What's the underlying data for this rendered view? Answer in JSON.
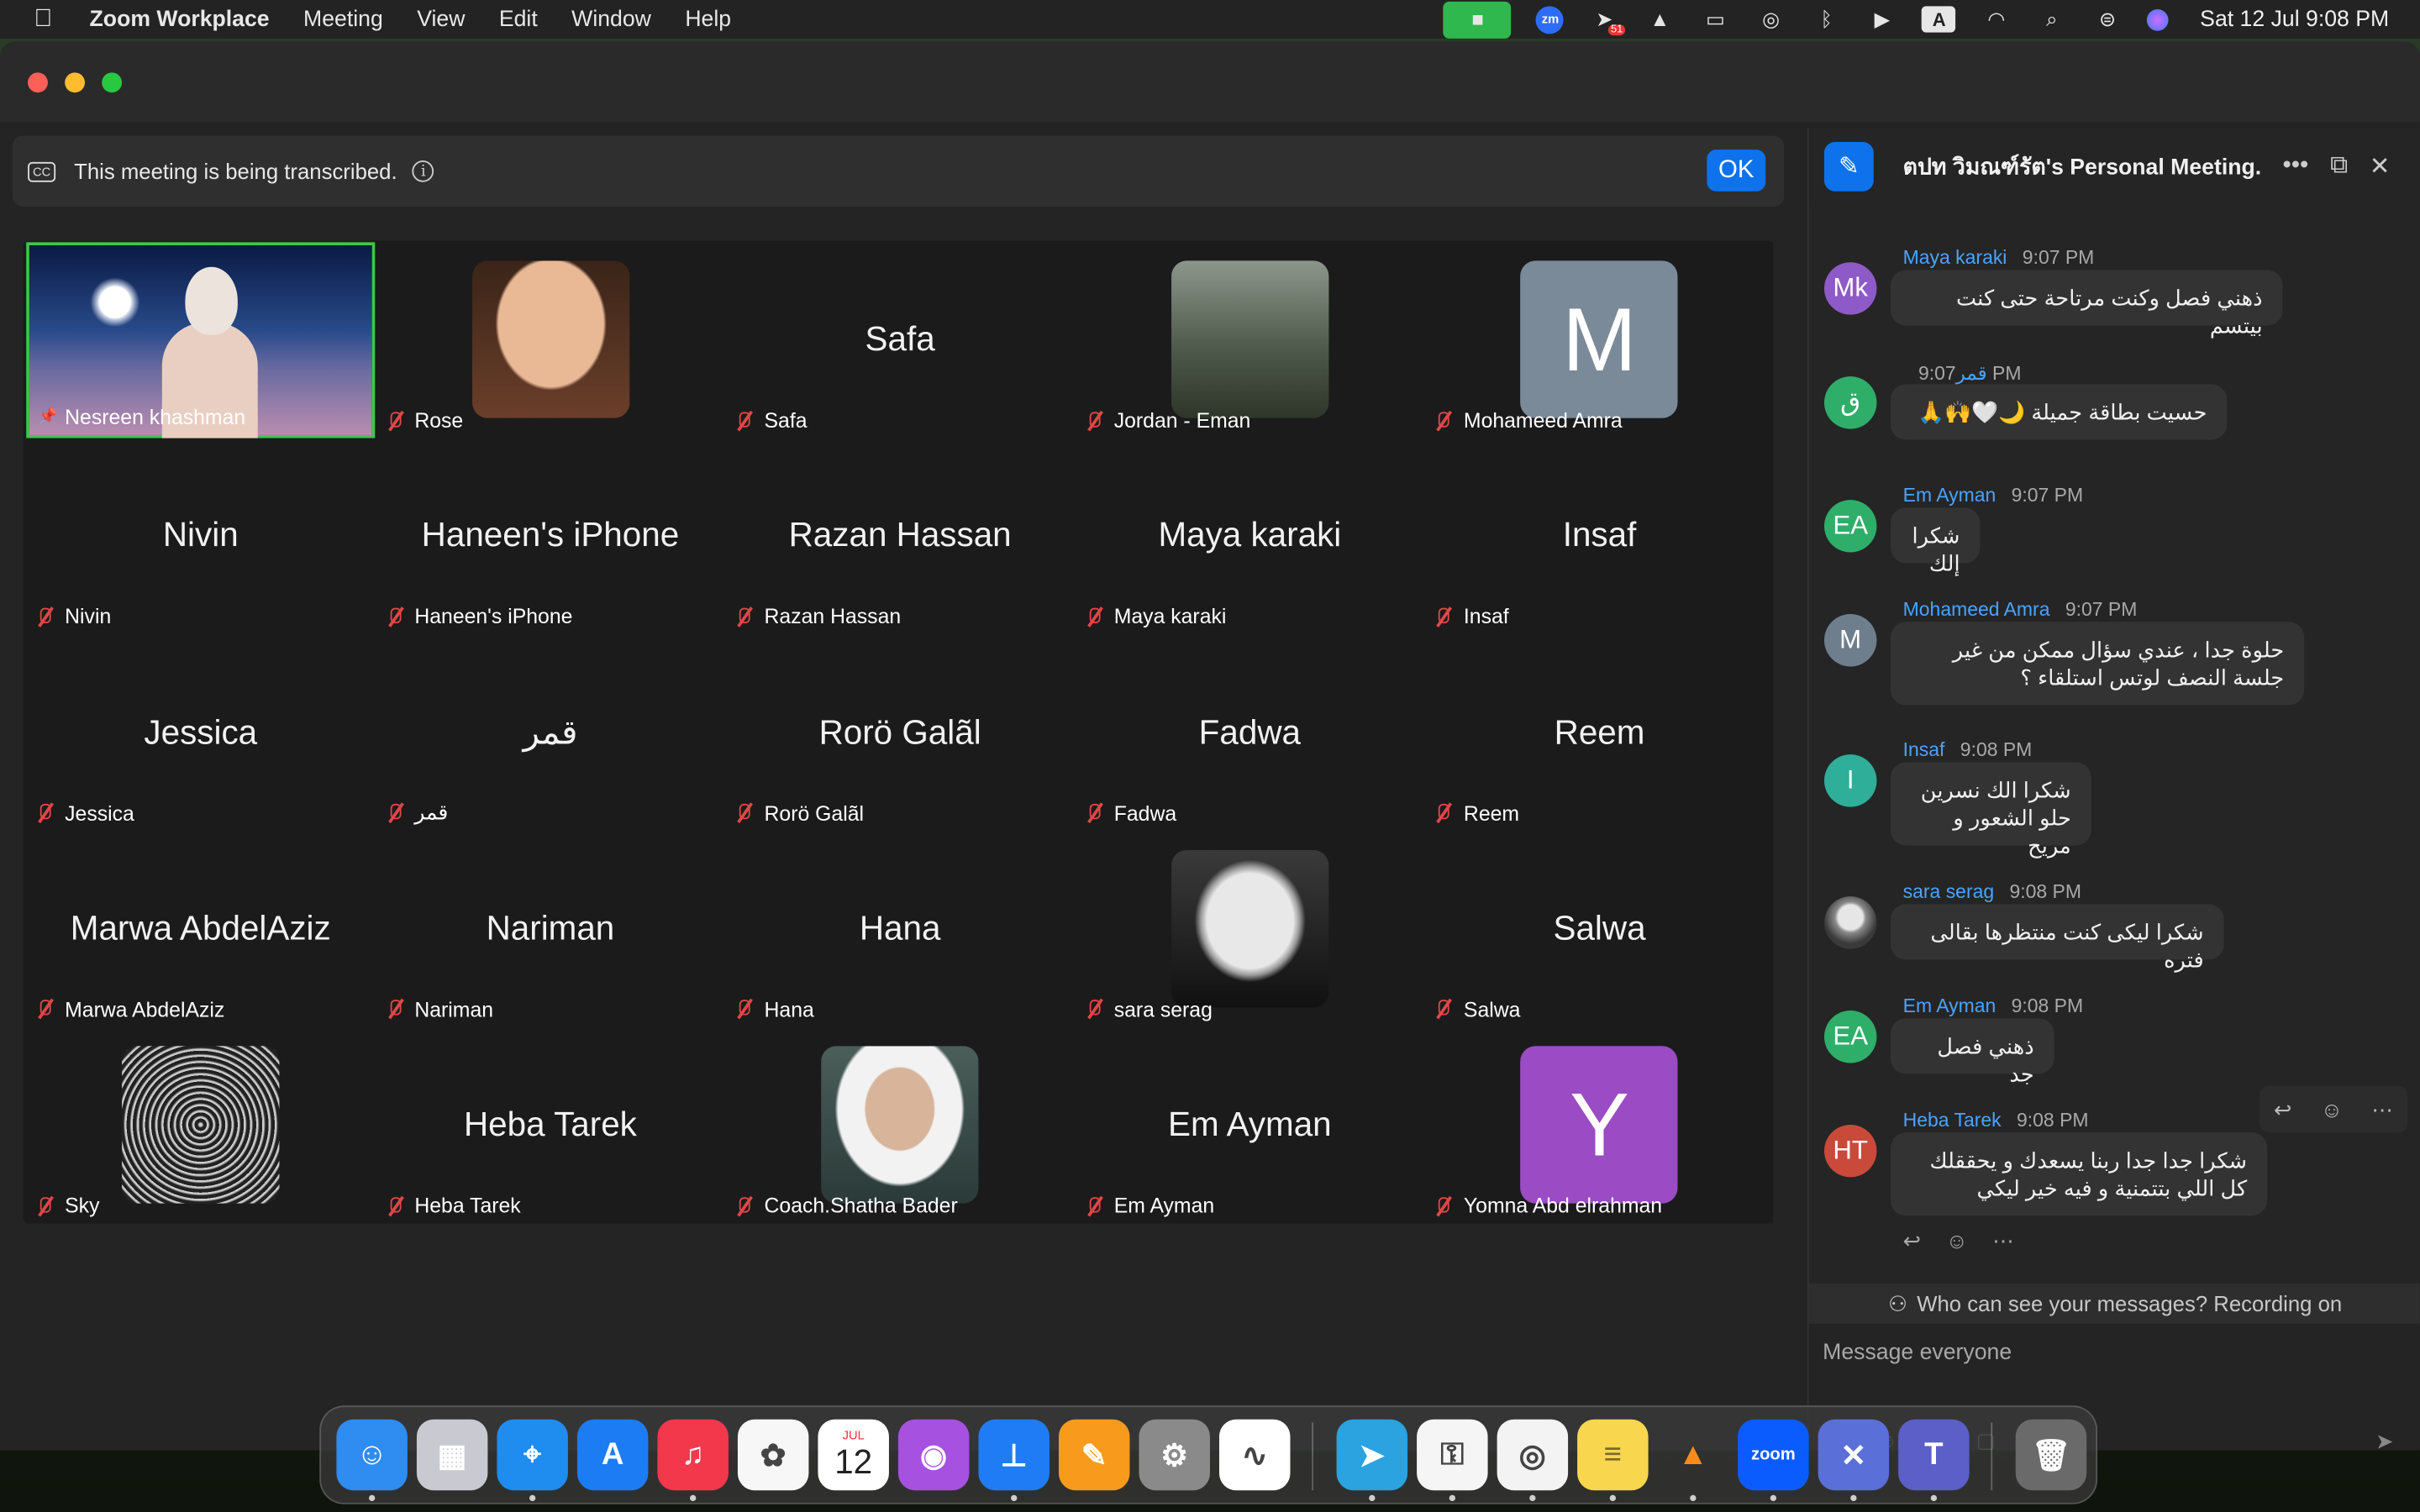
{
  "menubar": {
    "apple_icon": "apple-logo-icon",
    "app_name": "Zoom Workplace",
    "menus": [
      "Meeting",
      "View",
      "Edit",
      "Window",
      "Help"
    ],
    "status_icons": [
      "zoom-camera-icon",
      "zoom-app-icon",
      "notification-badge-icon",
      "vlc-cone-icon",
      "battery-icon",
      "airdrop-icon",
      "bluetooth-icon",
      "play-circle-icon",
      "input-source-icon",
      "wifi-icon",
      "search-icon",
      "control-center-icon",
      "siri-icon"
    ],
    "notification_count": "51",
    "input_source": "A",
    "clock": "Sat 12 Jul  9:08 PM"
  },
  "banner": {
    "text": "This meeting is being transcribed.",
    "ok_label": "OK",
    "cc_label": "CC"
  },
  "gallery": {
    "tiles": [
      {
        "name": "Nesreen khashman",
        "big_name": "",
        "kind": "video",
        "pinned": true,
        "muted": false
      },
      {
        "name": "Rose",
        "big_name": "",
        "kind": "photo",
        "muted": true
      },
      {
        "name": "Safa",
        "big_name": "Safa",
        "kind": "name",
        "muted": true
      },
      {
        "name": "Jordan - Eman",
        "big_name": "",
        "kind": "photo",
        "muted": true
      },
      {
        "name": "Mohameed Amra",
        "big_name": "",
        "kind": "letter",
        "letter": "M",
        "color": "#7b8a99",
        "muted": true
      },
      {
        "name": "Nivin",
        "big_name": "Nivin",
        "kind": "name",
        "muted": true
      },
      {
        "name": "Haneen's iPhone",
        "big_name": "Haneen's iPhone",
        "kind": "name",
        "muted": true
      },
      {
        "name": "Razan Hassan",
        "big_name": "Razan Hassan",
        "kind": "name",
        "muted": true
      },
      {
        "name": "Maya karaki",
        "big_name": "Maya karaki",
        "kind": "name",
        "muted": true
      },
      {
        "name": "Insaf",
        "big_name": "Insaf",
        "kind": "name",
        "muted": true
      },
      {
        "name": "Jessica",
        "big_name": "Jessica",
        "kind": "name",
        "muted": true
      },
      {
        "name": "قمر",
        "big_name": "قمر",
        "kind": "name",
        "muted": true
      },
      {
        "name": "Rorö Galãl",
        "big_name": "Rorö Galãl",
        "kind": "name",
        "muted": true
      },
      {
        "name": "Fadwa",
        "big_name": "Fadwa",
        "kind": "name",
        "muted": true
      },
      {
        "name": "Reem",
        "big_name": "Reem",
        "kind": "name",
        "muted": true
      },
      {
        "name": "Marwa AbdelAziz",
        "big_name": "Marwa AbdelAziz",
        "kind": "name",
        "muted": true
      },
      {
        "name": "Nariman",
        "big_name": "Nariman",
        "kind": "name",
        "muted": true
      },
      {
        "name": "Hana",
        "big_name": "Hana",
        "kind": "name",
        "muted": true
      },
      {
        "name": "sara serag",
        "big_name": "",
        "kind": "photo",
        "muted": true
      },
      {
        "name": "Salwa",
        "big_name": "Salwa",
        "kind": "name",
        "muted": true
      },
      {
        "name": "Sky",
        "big_name": "",
        "kind": "photo",
        "muted": true
      },
      {
        "name": "Heba Tarek",
        "big_name": "Heba Tarek",
        "kind": "name",
        "muted": true
      },
      {
        "name": "Coach.Shatha Bader",
        "big_name": "",
        "kind": "photo",
        "muted": true
      },
      {
        "name": "Em Ayman",
        "big_name": "Em Ayman",
        "kind": "name",
        "muted": true
      },
      {
        "name": "Yomna Abd elrahman",
        "big_name": "",
        "kind": "letter",
        "letter": "Y",
        "color": "#9b4bc4",
        "muted": true
      }
    ]
  },
  "chat": {
    "title": "ตปท วิมณฑ์รัต's Personal Meeting...",
    "messages": [
      {
        "avatar": "Mk",
        "avatar_color": "#8e5ac8",
        "sender": "Maya karaki",
        "time": "9:07 PM",
        "text": "ذهني فصل وكنت مرتاحة حتى كنت بيتسم"
      },
      {
        "avatar": "ق",
        "avatar_color": "#2fae6a",
        "sender": "قمر",
        "time": "9:07 PM",
        "text": "حسيت بطاقة جميلة 🌙🤍🙌🙏"
      },
      {
        "avatar": "EA",
        "avatar_color": "#2fae6a",
        "sender": "Em Ayman",
        "time": "9:07 PM",
        "text": "شكرا إلك"
      },
      {
        "avatar": "M",
        "avatar_color": "#6f7e8c",
        "sender": "Mohameed Amra",
        "time": "9:07 PM",
        "text": "حلوة جدا ، عندي سؤال ممكن من غير جلسة النصف لوتس استلقاء ؟"
      },
      {
        "avatar": "I",
        "avatar_color": "#2fae9a",
        "sender": "Insaf",
        "time": "9:08 PM",
        "text": "شكرا الك نسرين حلو الشعور و مريح"
      },
      {
        "avatar": "",
        "avatar_color": "#cccccc",
        "sender": "sara serag",
        "time": "9:08 PM",
        "text": "شكرا ليكى كنت منتظرها بقالى فتره"
      },
      {
        "avatar": "EA",
        "avatar_color": "#2fae6a",
        "sender": "Em Ayman",
        "time": "9:08 PM",
        "text": "ذهني فصل جد"
      },
      {
        "avatar": "HT",
        "avatar_color": "#c94a3a",
        "sender": "Heba Tarek",
        "time": "9:08 PM",
        "text": "شكرا جدا جدا ربنا يسعدك و يحققلك كل اللي بتتمنية و فيه خير ليكي"
      }
    ],
    "privacy_text": "Who can see your messages? Recording on",
    "input_placeholder": "Message everyone"
  },
  "dock": {
    "items": [
      {
        "name": "finder-icon",
        "color": "#2f8cf0",
        "glyph": "☺",
        "running": true
      },
      {
        "name": "launchpad-icon",
        "color": "#c9c9d1",
        "glyph": "▦",
        "running": false
      },
      {
        "name": "safari-icon",
        "color": "#1f8cf0",
        "glyph": "⌖",
        "running": true
      },
      {
        "name": "app-store-icon",
        "color": "#1c7cf4",
        "glyph": "A",
        "running": false
      },
      {
        "name": "music-icon",
        "color": "#f3384c",
        "glyph": "♫",
        "running": true
      },
      {
        "name": "photos-icon",
        "color": "#f7f7f7",
        "glyph": "✿",
        "running": false
      },
      {
        "name": "calendar-icon",
        "color": "#ffffff",
        "glyph": "12",
        "running": false
      },
      {
        "name": "podcasts-icon",
        "color": "#a651e0",
        "glyph": "◉",
        "running": false
      },
      {
        "name": "keynote-icon",
        "color": "#1f7cf4",
        "glyph": "⊥",
        "running": true
      },
      {
        "name": "pages-icon",
        "color": "#f89b1c",
        "glyph": "✎",
        "running": false
      },
      {
        "name": "system-settings-icon",
        "color": "#8a8a8a",
        "glyph": "⚙",
        "running": false
      },
      {
        "name": "freeform-icon",
        "color": "#ffffff",
        "glyph": "∿",
        "running": false
      },
      {
        "name": "telegram-icon",
        "color": "#2aa3e0",
        "glyph": "➤",
        "running": true
      },
      {
        "name": "passwords-icon",
        "color": "#f5f5f5",
        "glyph": "⚿",
        "running": true
      },
      {
        "name": "chrome-icon",
        "color": "#f3f3f3",
        "glyph": "◎",
        "running": true
      },
      {
        "name": "notes-icon",
        "color": "#f8d64e",
        "glyph": "≡",
        "running": true
      },
      {
        "name": "vlc-icon",
        "color": "#2b2b2b",
        "glyph": "▲",
        "running": true
      },
      {
        "name": "zoom-icon",
        "color": "#0b5cff",
        "glyph": "zoom",
        "running": true
      },
      {
        "name": "xcode-tools-icon",
        "color": "#5a6fd8",
        "glyph": "✕",
        "running": true
      },
      {
        "name": "teams-icon",
        "color": "#5b5fc7",
        "glyph": "T",
        "running": true
      },
      {
        "name": "trash-icon",
        "color": "#6a6a6a",
        "glyph": "🗑",
        "running": false
      }
    ],
    "calendar_month": "JUL"
  },
  "colors": {
    "zoom_blue": "#0e72ed",
    "active_speaker_border": "#3ec64c",
    "muted_red": "#e24646",
    "sender_blue": "#4aa3ff"
  }
}
